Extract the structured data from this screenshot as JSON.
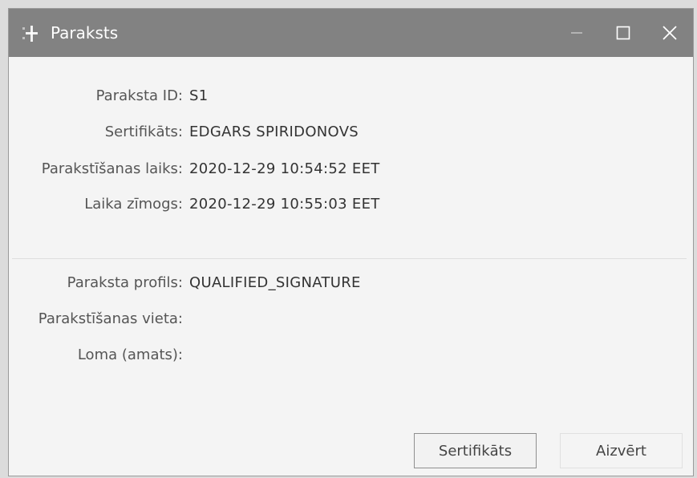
{
  "window": {
    "title": "Paraksts",
    "controls": {
      "minimize": "minimize-icon",
      "maximize": "maximize-icon",
      "close": "close-icon"
    }
  },
  "fields": [
    {
      "label": "Paraksta ID:",
      "value": "S1"
    },
    {
      "label": "Sertifikāts:",
      "value": "EDGARS SPIRIDONOVS"
    },
    {
      "label": "Parakstīšanas laiks:",
      "value": "2020-12-29 10:54:52 EET"
    },
    {
      "label": "Laika zīmogs:",
      "value": "2020-12-29 10:55:03 EET"
    }
  ],
  "fields2": [
    {
      "label": "Paraksta profils:",
      "value": "QUALIFIED_SIGNATURE"
    },
    {
      "label": "Parakstīšanas vieta:",
      "value": ""
    },
    {
      "label": "Loma (amats):",
      "value": ""
    }
  ],
  "buttons": {
    "certificate": "Sertifikāts",
    "close": "Aizvērt"
  }
}
